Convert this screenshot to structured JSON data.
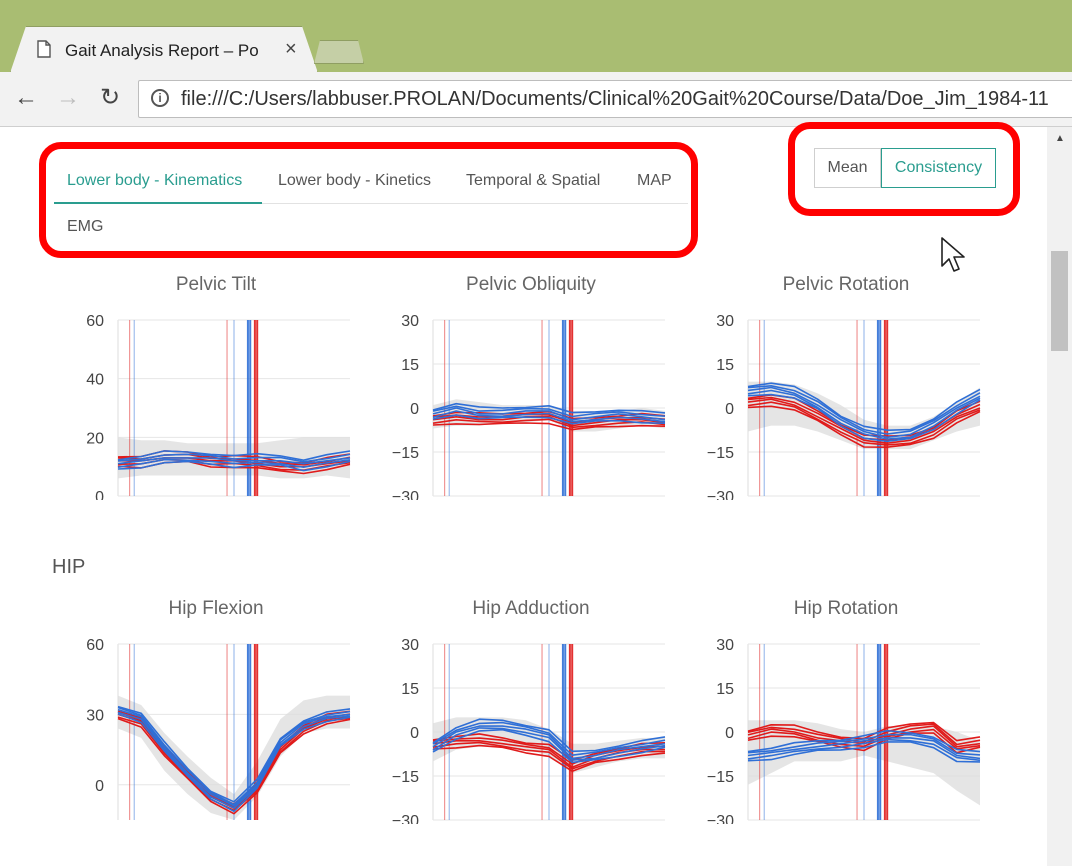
{
  "browser": {
    "tab_title": "Gait Analysis Report – Po",
    "url": "file:///C:/Users/labbuser.PROLAN/Documents/Clinical%20Gait%20Course/Data/Doe_Jim_1984-11"
  },
  "report_tabs": [
    {
      "label": "Lower body - Kinematics",
      "active": true
    },
    {
      "label": "Lower body - Kinetics",
      "active": false
    },
    {
      "label": "Temporal & Spatial",
      "active": false
    },
    {
      "label": "MAP",
      "active": false
    },
    {
      "label": "EMG",
      "active": false
    }
  ],
  "view_toggle": {
    "mean_label": "Mean",
    "consistency_label": "Consistency",
    "selected": "Consistency"
  },
  "colors": {
    "accent": "#2a9d8f",
    "left": "#e01b1b",
    "right": "#2f6fd6",
    "normal_band": "#dcdcdc",
    "annotation": "#ff0000"
  },
  "sections": [
    {
      "title": "",
      "row": 0
    },
    {
      "title": "HIP",
      "row": 1
    }
  ],
  "chart_data": [
    {
      "type": "line",
      "title": "Pelvic Tilt",
      "ylim": [
        0,
        60
      ],
      "yticks": [
        "60",
        "40",
        "20",
        "0"
      ],
      "x": [
        0,
        10,
        20,
        30,
        40,
        50,
        60,
        70,
        80,
        90,
        100
      ],
      "band_low": [
        6,
        7,
        7,
        7,
        7,
        7,
        7,
        6,
        6,
        7,
        6
      ],
      "band_high": [
        20,
        19,
        19,
        18,
        18,
        18,
        18,
        19,
        20,
        20,
        20
      ],
      "series": [
        {
          "side": "left",
          "values": [
            12,
            12,
            13,
            13,
            12,
            12,
            11,
            10,
            10,
            11,
            12
          ]
        },
        {
          "side": "right",
          "values": [
            11,
            12,
            13,
            13,
            13,
            12,
            12,
            12,
            11,
            12,
            13
          ]
        }
      ],
      "events": {
        "left": [
          5,
          47,
          59,
          60
        ],
        "right": [
          7,
          50,
          56,
          57
        ]
      }
    },
    {
      "type": "line",
      "title": "Pelvic Obliquity",
      "ylim": [
        -30,
        30
      ],
      "yticks": [
        "30",
        "15",
        "0",
        "-15",
        "-30"
      ],
      "x": [
        0,
        10,
        20,
        30,
        40,
        50,
        60,
        70,
        80,
        90,
        100
      ],
      "band_low": [
        -7,
        -6,
        -6,
        -5,
        -5,
        -4,
        -8,
        -8,
        -7,
        -6,
        -7
      ],
      "band_high": [
        1,
        3,
        2,
        1,
        1,
        1,
        -1,
        -1,
        -1,
        0,
        -1
      ],
      "series": [
        {
          "side": "left",
          "values": [
            -4,
            -3,
            -4,
            -4,
            -3,
            -3,
            -6,
            -5,
            -4,
            -4,
            -5
          ]
        },
        {
          "side": "right",
          "values": [
            -2,
            0,
            -2,
            -2,
            -1,
            -1,
            -4,
            -3,
            -2,
            -3,
            -4
          ]
        }
      ],
      "events": {
        "left": [
          5,
          47,
          59,
          60
        ],
        "right": [
          7,
          50,
          56,
          57
        ]
      }
    },
    {
      "type": "line",
      "title": "Pelvic Rotation",
      "ylim": [
        -30,
        30
      ],
      "yticks": [
        "30",
        "15",
        "0",
        "-15",
        "-30"
      ],
      "x": [
        0,
        10,
        20,
        30,
        40,
        50,
        60,
        70,
        80,
        90,
        100
      ],
      "band_low": [
        -8,
        -6,
        -6,
        -8,
        -11,
        -14,
        -14,
        -14,
        -11,
        -8,
        -6
      ],
      "band_high": [
        9,
        9,
        8,
        5,
        1,
        -4,
        -6,
        -6,
        -3,
        2,
        7
      ],
      "series": [
        {
          "side": "left",
          "values": [
            2,
            3,
            1,
            -3,
            -7,
            -11,
            -12,
            -11,
            -8,
            -3,
            0
          ]
        },
        {
          "side": "right",
          "values": [
            6,
            7,
            5,
            1,
            -4,
            -8,
            -10,
            -9,
            -5,
            0,
            4
          ]
        }
      ],
      "events": {
        "left": [
          5,
          47,
          59,
          60
        ],
        "right": [
          7,
          50,
          56,
          57
        ]
      }
    },
    {
      "type": "line",
      "title": "Hip Flexion",
      "ylim": [
        -15,
        60
      ],
      "yticks": [
        "60",
        "30",
        "0"
      ],
      "ytick_values": [
        60,
        30,
        0
      ],
      "x": [
        0,
        10,
        20,
        30,
        40,
        50,
        60,
        70,
        80,
        90,
        100
      ],
      "band_low": [
        24,
        20,
        6,
        -4,
        -12,
        -15,
        -5,
        12,
        22,
        24,
        24
      ],
      "band_high": [
        38,
        34,
        22,
        12,
        3,
        -4,
        10,
        28,
        36,
        38,
        38
      ],
      "series": [
        {
          "side": "left",
          "values": [
            30,
            27,
            14,
            4,
            -5,
            -10,
            -2,
            15,
            24,
            28,
            29
          ]
        },
        {
          "side": "right",
          "values": [
            32,
            29,
            16,
            5,
            -4,
            -9,
            0,
            18,
            26,
            29,
            30
          ]
        }
      ],
      "events": {
        "left": [
          5,
          47,
          59,
          60
        ],
        "right": [
          7,
          50,
          56,
          57
        ]
      }
    },
    {
      "type": "line",
      "title": "Hip Adduction",
      "ylim": [
        -30,
        30
      ],
      "yticks": [
        "30",
        "15",
        "0",
        "-15",
        "-30"
      ],
      "x": [
        0,
        10,
        20,
        30,
        40,
        50,
        60,
        70,
        80,
        90,
        100
      ],
      "band_low": [
        -10,
        -6,
        -5,
        -5,
        -6,
        -8,
        -14,
        -12,
        -10,
        -9,
        -9
      ],
      "band_high": [
        3,
        5,
        5,
        5,
        4,
        1,
        -4,
        -4,
        -3,
        -2,
        -2
      ],
      "series": [
        {
          "side": "left",
          "values": [
            -4,
            -3,
            -3,
            -4,
            -5,
            -6,
            -12,
            -9,
            -7,
            -6,
            -6
          ]
        },
        {
          "side": "right",
          "values": [
            -5,
            0,
            2,
            2,
            1,
            -1,
            -9,
            -8,
            -6,
            -5,
            -4
          ]
        }
      ],
      "events": {
        "left": [
          5,
          47,
          59,
          60
        ],
        "right": [
          7,
          50,
          56,
          57
        ]
      }
    },
    {
      "type": "line",
      "title": "Hip Rotation",
      "ylim": [
        -30,
        30
      ],
      "yticks": [
        "30",
        "15",
        "0",
        "-15",
        "-30"
      ],
      "x": [
        0,
        10,
        20,
        30,
        40,
        50,
        60,
        70,
        80,
        90,
        100
      ],
      "band_low": [
        -18,
        -14,
        -10,
        -10,
        -10,
        -8,
        -10,
        -12,
        -14,
        -20,
        -25
      ],
      "band_high": [
        4,
        4,
        4,
        3,
        1,
        0,
        2,
        2,
        2,
        0,
        -3
      ],
      "series": [
        {
          "side": "left",
          "values": [
            -1,
            1,
            0,
            -2,
            -3,
            -4,
            -1,
            1,
            2,
            -5,
            -4
          ]
        },
        {
          "side": "right",
          "values": [
            -8,
            -7,
            -6,
            -5,
            -4,
            -3,
            -2,
            -2,
            -3,
            -8,
            -9
          ]
        }
      ],
      "events": {
        "left": [
          5,
          47,
          59,
          60
        ],
        "right": [
          7,
          50,
          56,
          57
        ]
      }
    }
  ]
}
